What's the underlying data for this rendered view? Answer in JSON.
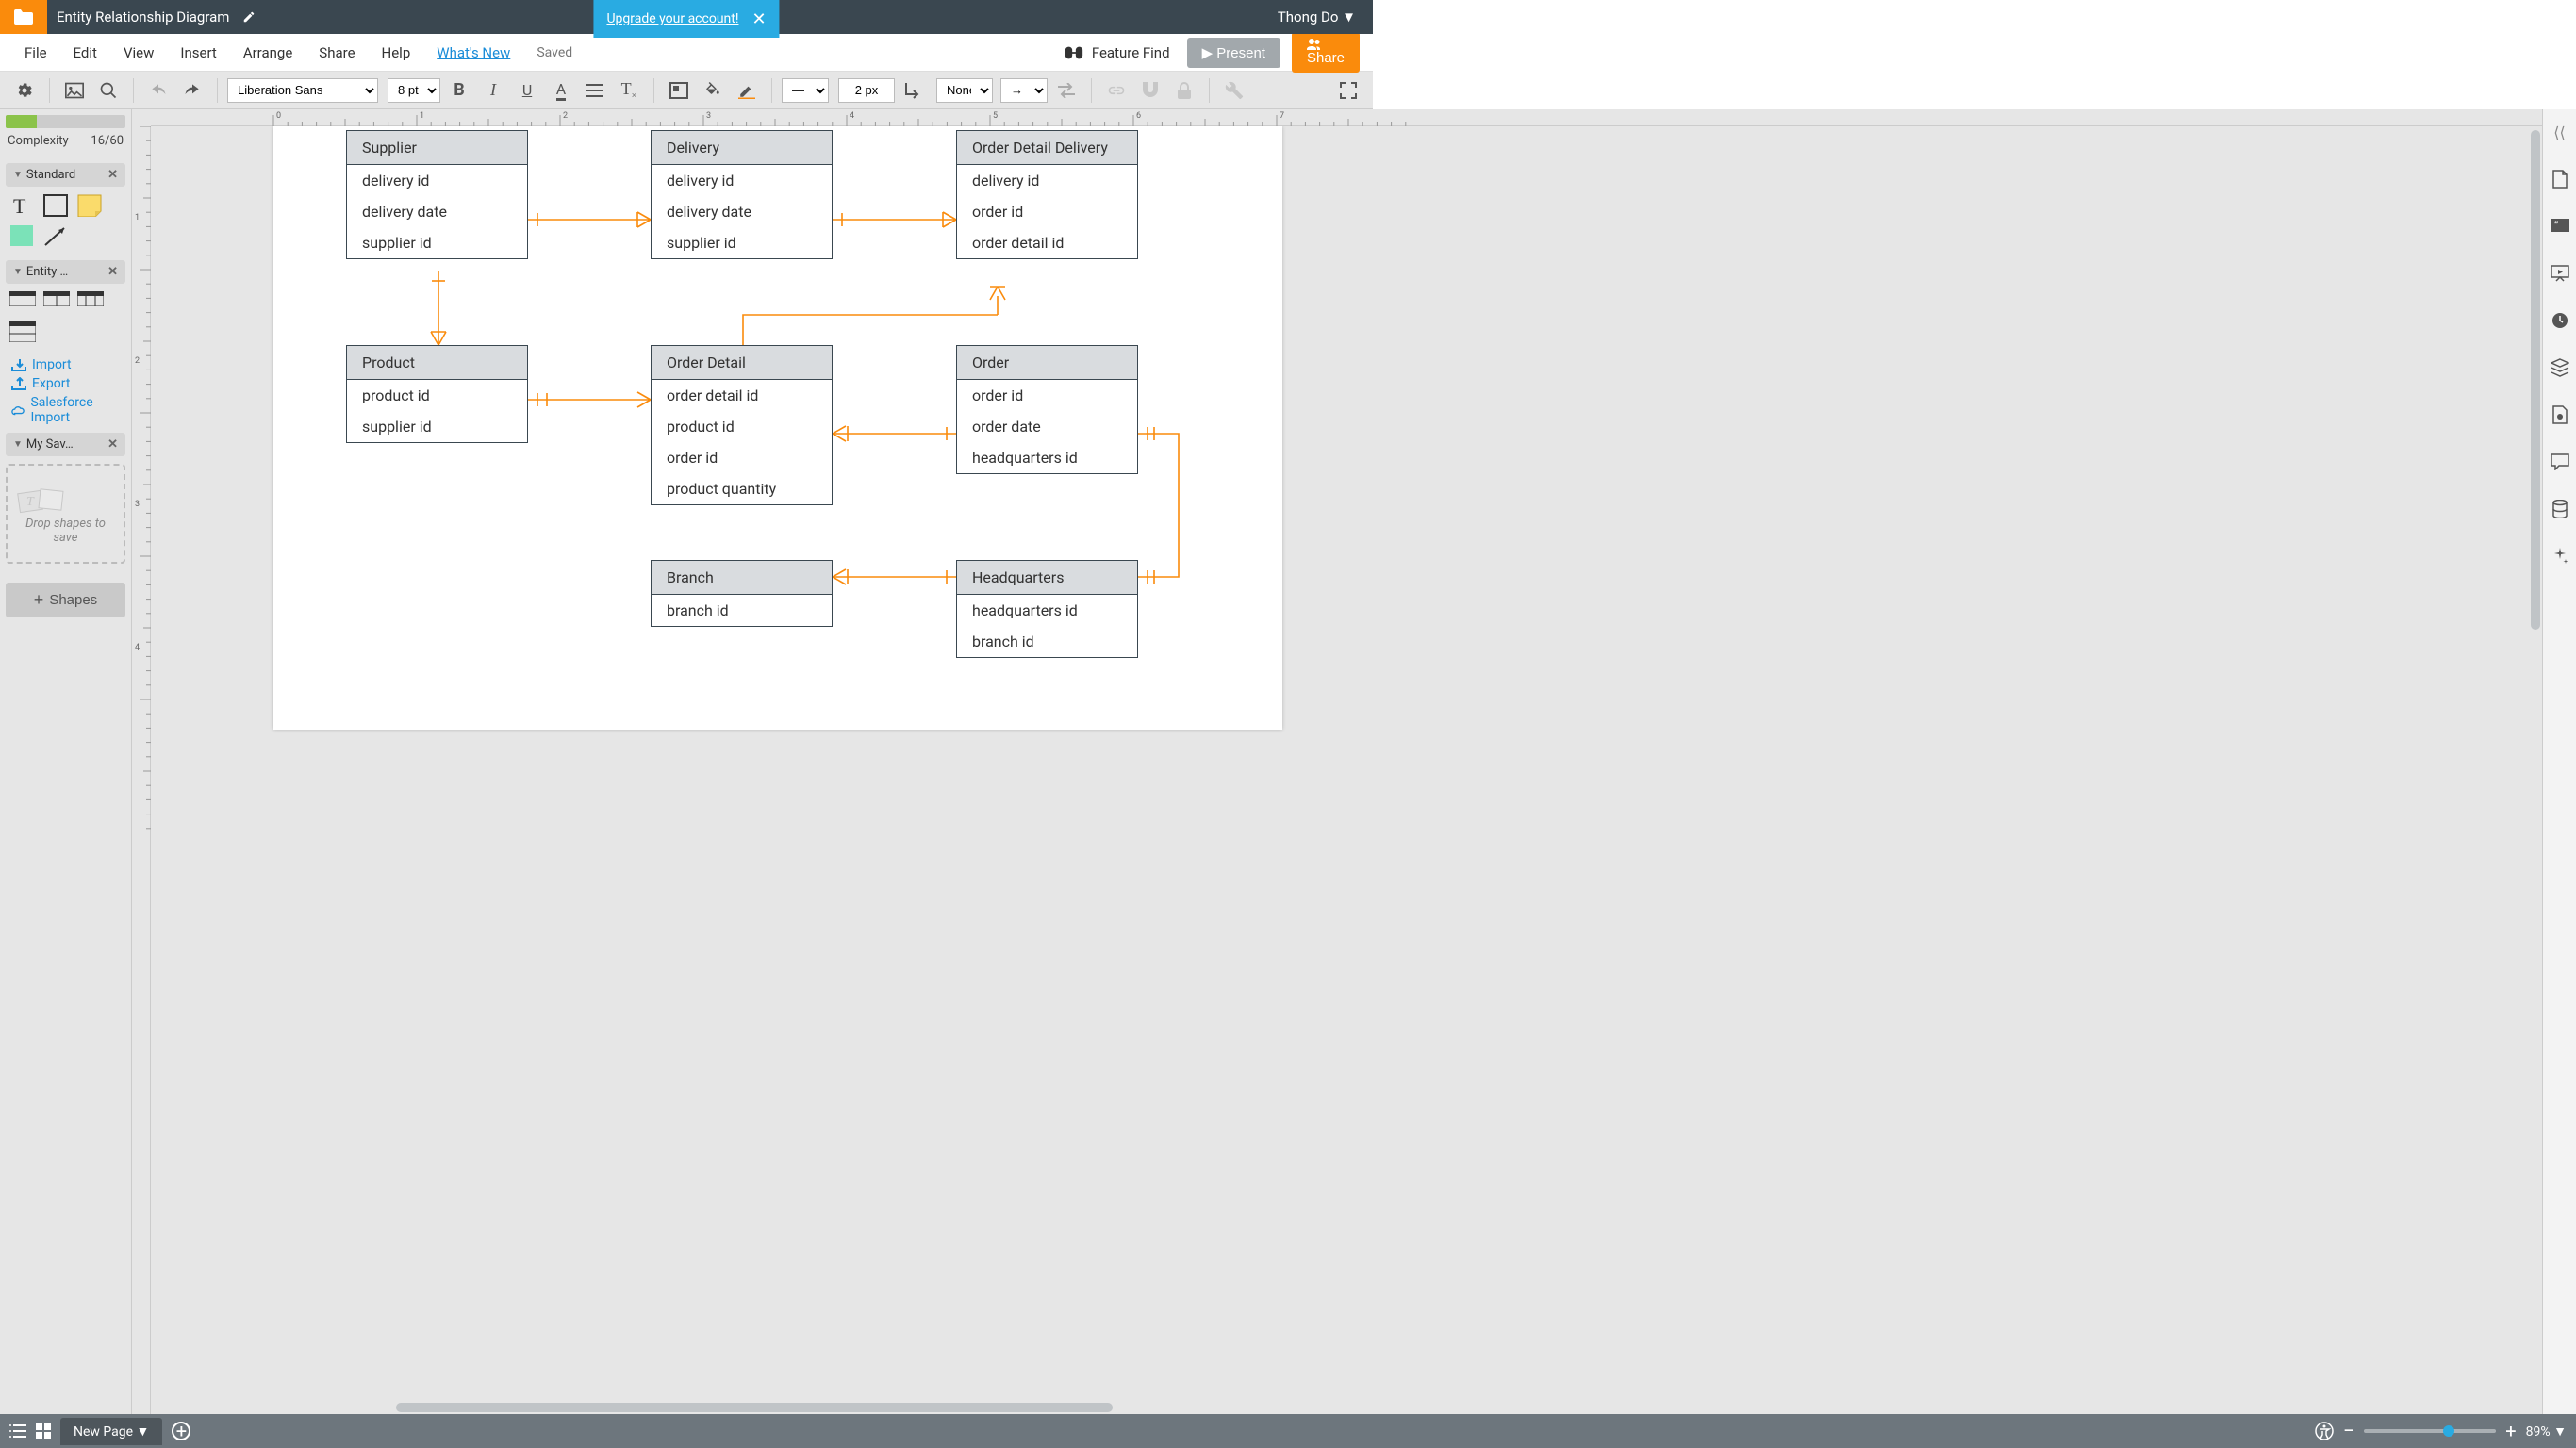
{
  "app": {
    "title": "Entity Relationship Diagram",
    "upgrade_text": "Upgrade your account!",
    "user_name": "Thong Do"
  },
  "menus": {
    "file": "File",
    "edit": "Edit",
    "view": "View",
    "insert": "Insert",
    "arrange": "Arrange",
    "share": "Share",
    "help": "Help",
    "whats_new": "What's New",
    "saved": "Saved",
    "feature_find": "Feature Find",
    "present": "Present",
    "share_btn": "Share"
  },
  "toolbar": {
    "font": "Liberation Sans",
    "font_size": "8 pt",
    "stroke_width": "2 px",
    "line_style": "None"
  },
  "left": {
    "complexity_label": "Complexity",
    "complexity_value": "16/60",
    "group_standard": "Standard",
    "group_entity": "Entity …",
    "group_mysaved": "My Sav…",
    "import": "Import",
    "export": "Export",
    "salesforce": "Salesforce Import",
    "dropzone": "Drop shapes to save",
    "shapes_btn": "Shapes"
  },
  "bottom": {
    "tab_label": "New Page",
    "zoom_pct": "89%"
  },
  "entities": {
    "supplier": {
      "title": "Supplier",
      "rows": [
        "delivery id",
        "delivery date",
        "supplier id"
      ]
    },
    "delivery": {
      "title": "Delivery",
      "rows": [
        "delivery id",
        "delivery date",
        "supplier id"
      ]
    },
    "odd": {
      "title": "Order Detail Delivery",
      "rows": [
        "delivery id",
        "order id",
        "order detail id"
      ]
    },
    "product": {
      "title": "Product",
      "rows": [
        "product id",
        "supplier id"
      ]
    },
    "od": {
      "title": "Order Detail",
      "rows": [
        "order detail id",
        "product id",
        "order id",
        "product quantity"
      ]
    },
    "order": {
      "title": "Order",
      "rows": [
        "order id",
        "order date",
        "headquarters id"
      ]
    },
    "branch": {
      "title": "Branch",
      "rows": [
        "branch id"
      ]
    },
    "hq": {
      "title": "Headquarters",
      "rows": [
        "headquarters id",
        "branch id"
      ]
    }
  },
  "ruler_h": [
    "0",
    "1",
    "2",
    "3",
    "4",
    "5",
    "6",
    "7"
  ],
  "ruler_v": [
    "1",
    "2",
    "3",
    "4"
  ]
}
